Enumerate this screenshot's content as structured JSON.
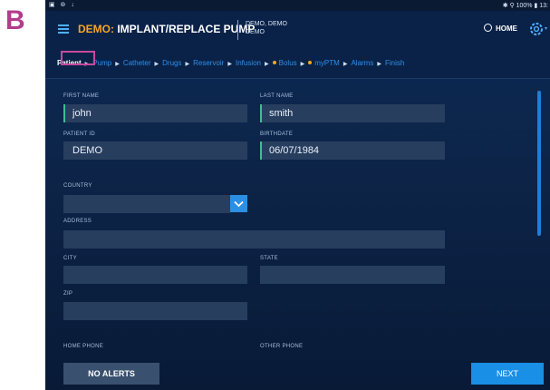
{
  "panel_letter": "B",
  "status_bar": {
    "left_icons": "▣ ⊚ ↓",
    "right": "✱ ⚲ 100% ▮ 13:"
  },
  "app_bar": {
    "title_demo": "DEMO:",
    "title_rest": " IMPLANT/REPLACE PUMP",
    "user_line1": "DEMO, DEMO",
    "user_line2": "DEMO",
    "home_label": "HOME"
  },
  "steps": [
    {
      "label": "Patient",
      "active": true
    },
    {
      "label": "Pump"
    },
    {
      "label": "Catheter"
    },
    {
      "label": "Drugs"
    },
    {
      "label": "Reservoir"
    },
    {
      "label": "Infusion"
    },
    {
      "label": "Bolus",
      "dot": true
    },
    {
      "label": "myPTM",
      "dot": true
    },
    {
      "label": "Alarms"
    },
    {
      "label": "Finish"
    }
  ],
  "form": {
    "first_name_label": "FIRST NAME",
    "first_name_value": "john",
    "last_name_label": "LAST NAME",
    "last_name_value": "smith",
    "patient_id_label": "PATIENT ID",
    "patient_id_value": "DEMO",
    "birthdate_label": "BIRTHDATE",
    "birthdate_value": "06/07/1984",
    "country_label": "COUNTRY",
    "address_label": "ADDRESS",
    "city_label": "CITY",
    "state_label": "STATE",
    "zip_label": "ZIP",
    "home_phone_label": "HOME PHONE",
    "other_phone_label": "OTHER PHONE"
  },
  "footer": {
    "no_alerts": "NO ALERTS",
    "next": "NEXT"
  },
  "colors": {
    "accent_demo": "#f5a623",
    "step_link": "#2f8fe8",
    "highlight": "#c8489e",
    "field_accent": "#3ec08f",
    "primary_button": "#1a8fe6"
  }
}
